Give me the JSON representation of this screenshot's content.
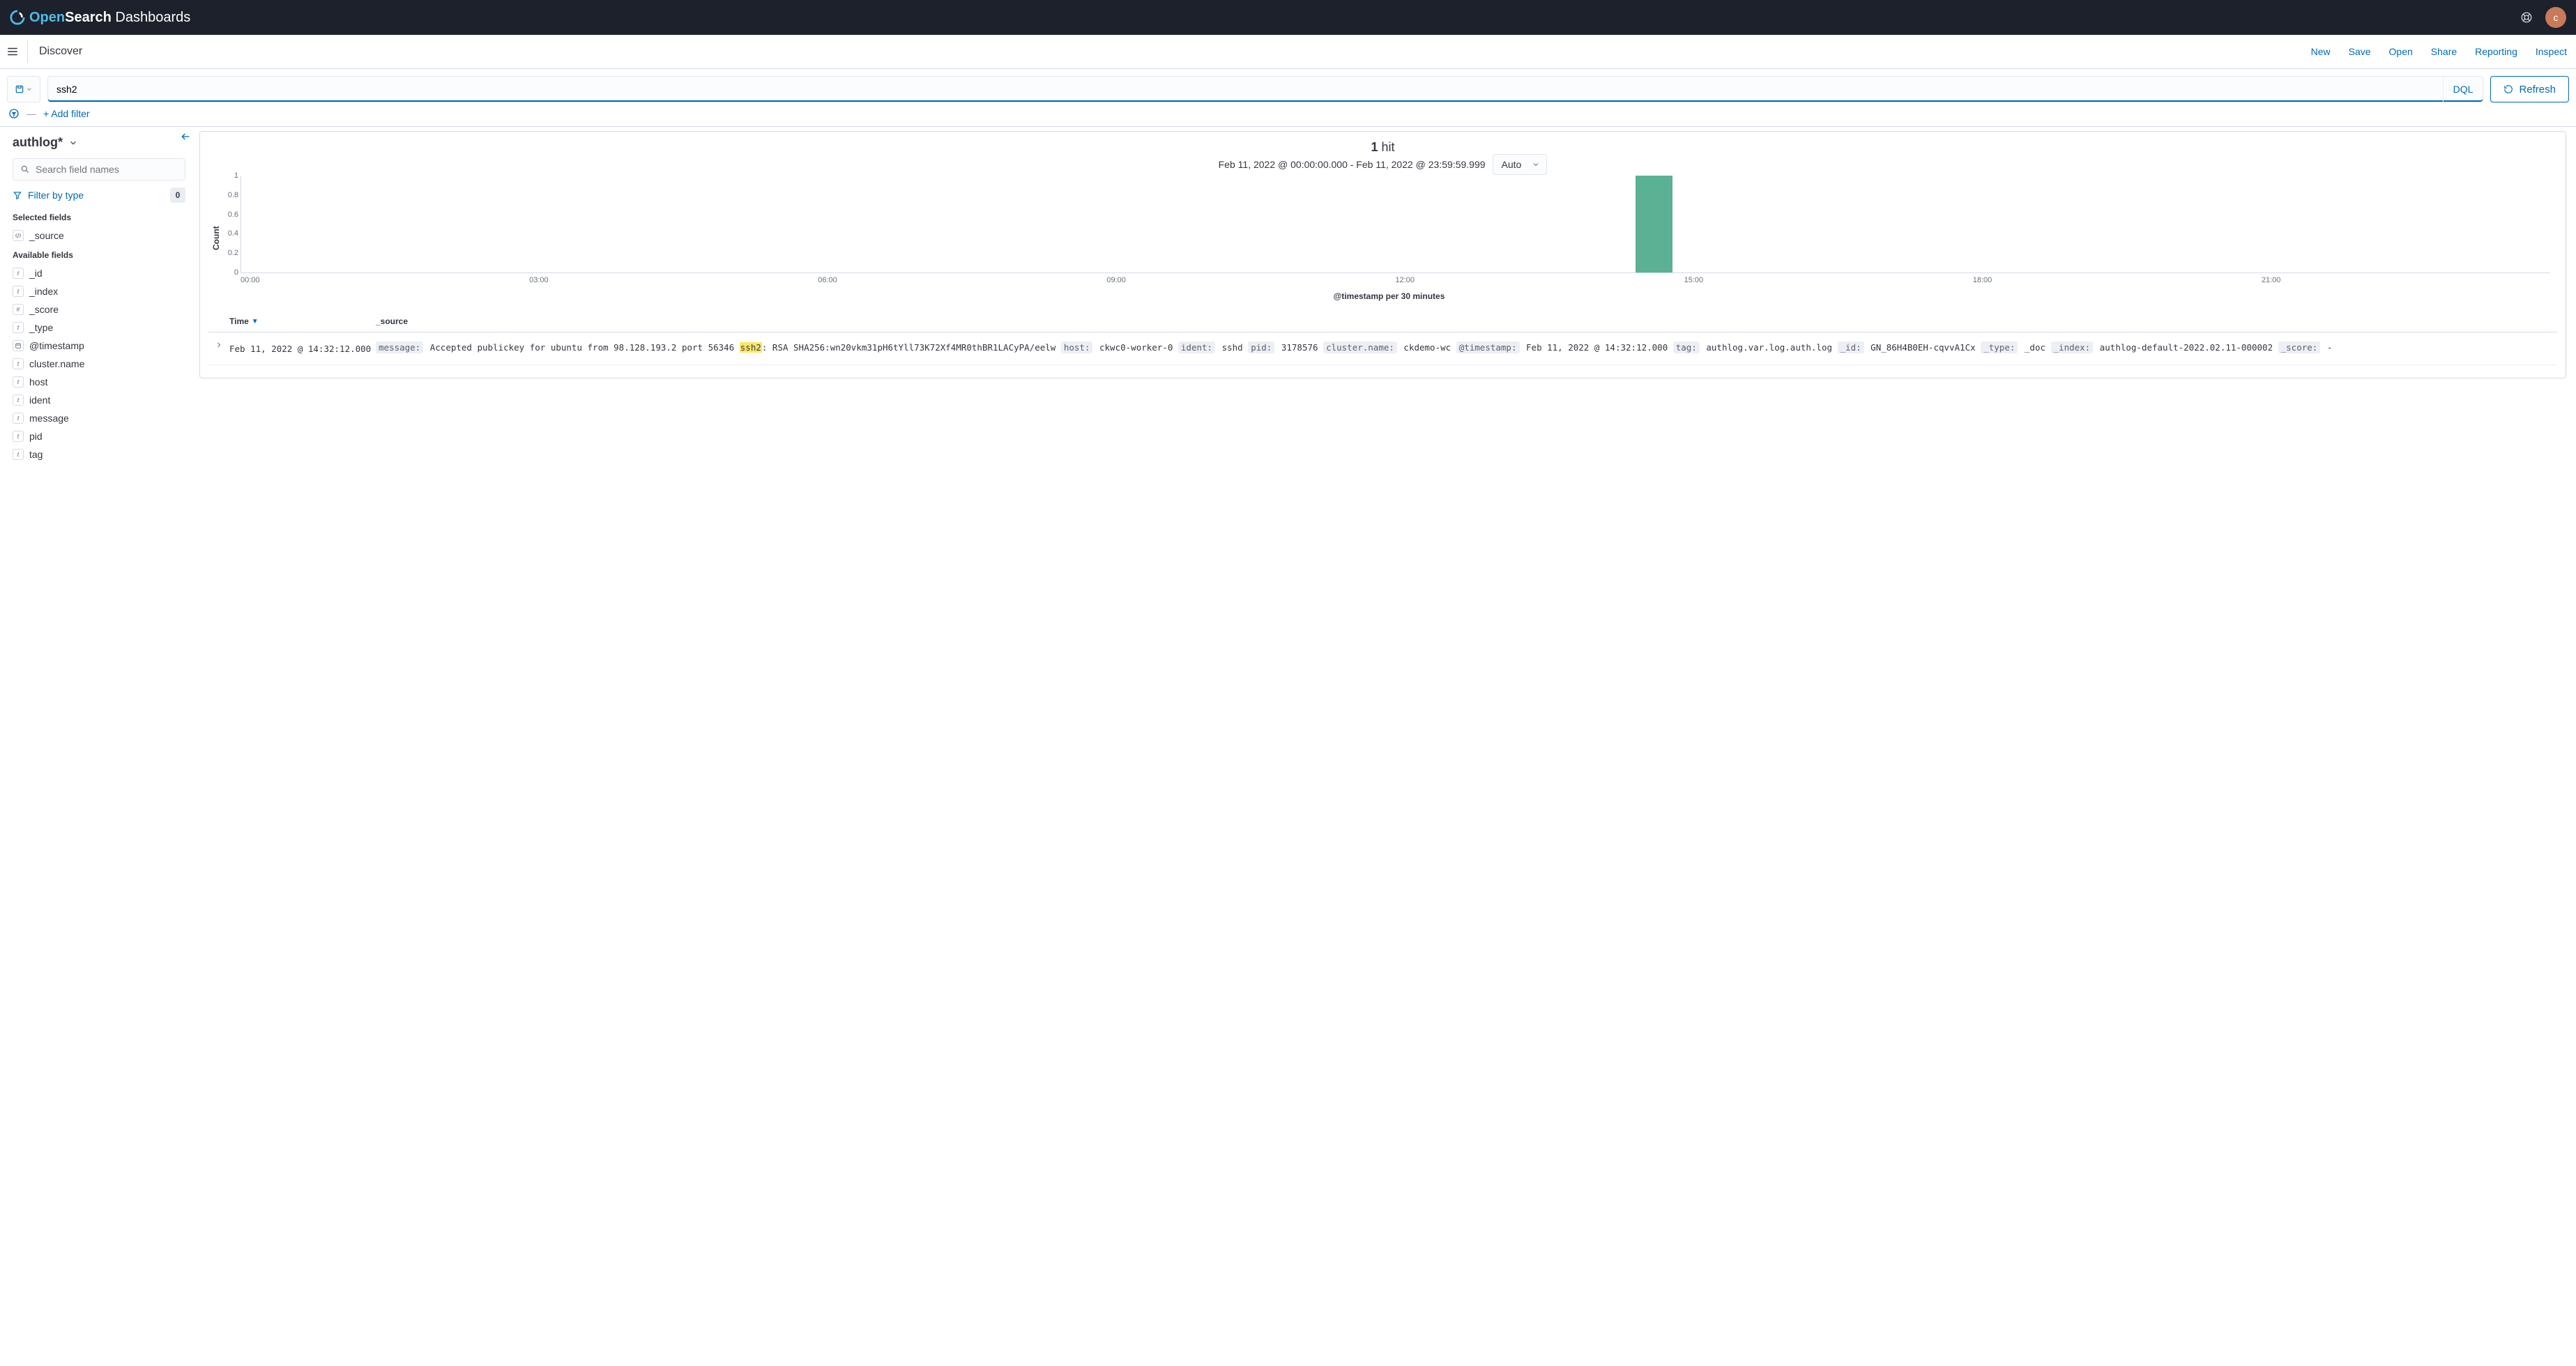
{
  "brand": {
    "open": "Open",
    "search": "Search",
    "dash": " Dashboards"
  },
  "avatar_initial": "c",
  "subheader": {
    "title": "Discover",
    "links": {
      "new": "New",
      "save": "Save",
      "open": "Open",
      "share": "Share",
      "reporting": "Reporting",
      "inspect": "Inspect"
    }
  },
  "query": {
    "value": "ssh2",
    "dql": "DQL",
    "refresh": "Refresh"
  },
  "filter": {
    "add": "+ Add filter"
  },
  "sidebar": {
    "index_pattern": "authlog*",
    "search_placeholder": "Search field names",
    "filter_by_type": "Filter by type",
    "filter_count": "0",
    "selected_label": "Selected fields",
    "available_label": "Available fields",
    "selected": [
      {
        "type": "src",
        "name": "_source"
      }
    ],
    "available": [
      {
        "type": "t",
        "name": "_id"
      },
      {
        "type": "t",
        "name": "_index"
      },
      {
        "type": "#",
        "name": "_score"
      },
      {
        "type": "t",
        "name": "_type"
      },
      {
        "type": "date",
        "name": "@timestamp"
      },
      {
        "type": "t",
        "name": "cluster.name"
      },
      {
        "type": "t",
        "name": "host"
      },
      {
        "type": "t",
        "name": "ident"
      },
      {
        "type": "t",
        "name": "message"
      },
      {
        "type": "t",
        "name": "pid"
      },
      {
        "type": "t",
        "name": "tag"
      }
    ]
  },
  "hits": {
    "count": "1",
    "label": "hit"
  },
  "range": "Feb 11, 2022 @ 00:00:00.000 - Feb 11, 2022 @ 23:59:59.999",
  "interval": "Auto",
  "chart_data": {
    "type": "bar",
    "ylabel": "Count",
    "xlabel": "@timestamp per 30 minutes",
    "ylim": [
      0,
      1
    ],
    "yticks": [
      0,
      0.2,
      0.4,
      0.6,
      0.8,
      1
    ],
    "xticks": [
      "00:00",
      "03:00",
      "06:00",
      "09:00",
      "12:00",
      "15:00",
      "18:00",
      "21:00"
    ],
    "bars": [
      {
        "x_fraction": 0.604,
        "height": 1
      }
    ]
  },
  "table": {
    "headers": {
      "time": "Time",
      "source": "_source"
    },
    "rows": [
      {
        "time": "Feb 11, 2022 @ 14:32:12.000",
        "fields": [
          {
            "k": "message:",
            "v_pre": "Accepted publickey for ubuntu from 98.128.193.2 port 56346 ",
            "hl": "ssh2",
            "v_post": ": RSA SHA256:wn20vkm31pH6tYll73K72Xf4MR0thBR1LACyPA/eelw"
          },
          {
            "k": "host:",
            "v": "ckwc0-worker-0"
          },
          {
            "k": "ident:",
            "v": "sshd"
          },
          {
            "k": "pid:",
            "v": "3178576"
          },
          {
            "k": "cluster.name:",
            "v": "ckdemo-wc"
          },
          {
            "k": "@timestamp:",
            "v": "Feb 11, 2022 @ 14:32:12.000"
          },
          {
            "k": "tag:",
            "v": "authlog.var.log.auth.log"
          },
          {
            "k": "_id:",
            "v": "GN_86H4B0EH-cqvvA1Cx"
          },
          {
            "k": "_type:",
            "v": "_doc"
          },
          {
            "k": "_index:",
            "v": "authlog-default-2022.02.11-000002"
          },
          {
            "k": "_score:",
            "v": " - "
          }
        ]
      }
    ]
  }
}
